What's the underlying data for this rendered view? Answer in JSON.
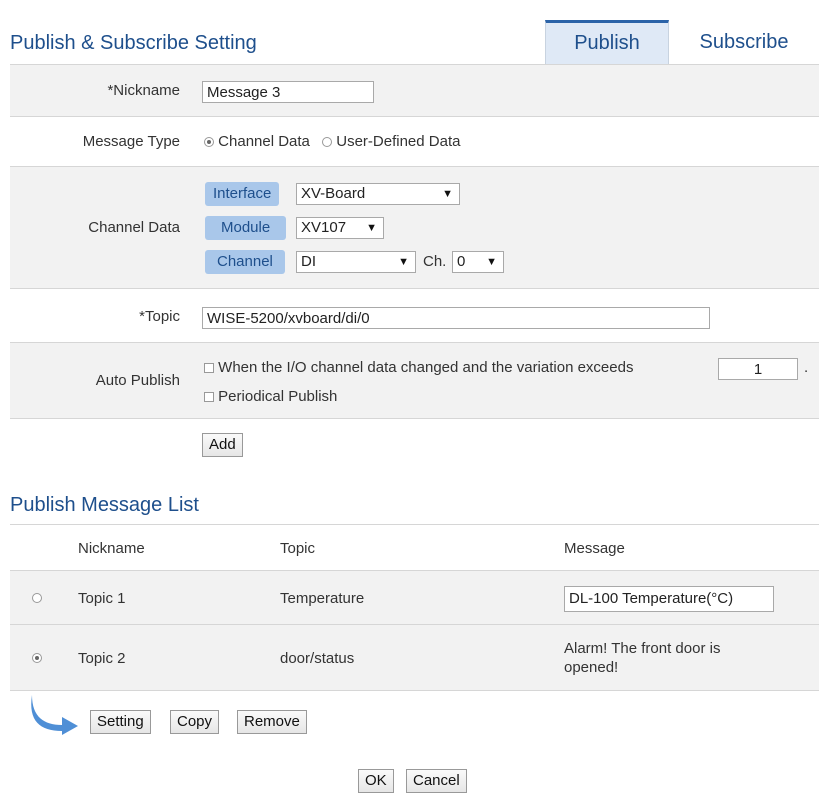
{
  "header": {
    "title": "Publish & Subscribe Setting",
    "tabs": [
      {
        "label": "Publish",
        "active": true
      },
      {
        "label": "Subscribe",
        "active": false
      }
    ]
  },
  "form": {
    "nickname": {
      "label": "*Nickname",
      "value": "Message 3"
    },
    "message_type": {
      "label": "Message Type",
      "options": [
        "Channel Data",
        "User-Defined Data"
      ],
      "selected": "Channel Data"
    },
    "channel_data": {
      "label": "Channel Data",
      "interface": {
        "label": "Interface",
        "value": "XV-Board"
      },
      "module": {
        "label": "Module",
        "value": "XV107"
      },
      "channel": {
        "label": "Channel",
        "value": "DI",
        "ch_label": "Ch.",
        "ch_value": "0"
      }
    },
    "topic": {
      "label": "*Topic",
      "value": "WISE-5200/xvboard/di/0"
    },
    "auto_publish": {
      "label": "Auto Publish",
      "option1": "When the I/O channel data changed and the variation exceeds",
      "variation_value": "1",
      "option1_suffix": ".",
      "option2": "Periodical Publish"
    },
    "add_label": "Add"
  },
  "list": {
    "title": "Publish Message List",
    "columns": [
      "Nickname",
      "Topic",
      "Message"
    ],
    "rows": [
      {
        "nickname": "Topic 1",
        "topic": "Temperature",
        "message": "DL-100 Temperature(°C)",
        "selected": false
      },
      {
        "nickname": "Topic 2",
        "topic": "door/status",
        "message": "Alarm! The front door is opened!",
        "selected": true
      }
    ],
    "actions": {
      "setting": "Setting",
      "copy": "Copy",
      "remove": "Remove"
    }
  },
  "footer": {
    "ok": "OK",
    "cancel": "Cancel"
  },
  "colors": {
    "accent": "#1e4f8c",
    "tag_bg": "#a9c7ea",
    "row_shade": "#f2f2f2",
    "arrow": "#4f8fd6"
  }
}
